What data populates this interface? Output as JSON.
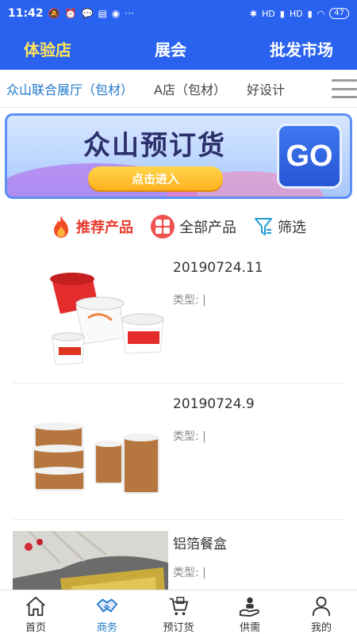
{
  "status_bar": {
    "time": "11:42",
    "battery": "47",
    "signal1": "HD",
    "signal2": "HD"
  },
  "header": {
    "items": [
      {
        "label": "体验店",
        "active": true
      },
      {
        "label": "展会",
        "active": false
      },
      {
        "label": "批发市场",
        "active": false
      }
    ]
  },
  "subtabs": [
    {
      "label": "众山联合展厅（包材）",
      "active": true
    },
    {
      "label": "A店（包材）",
      "active": false
    },
    {
      "label": "好设计",
      "active": false
    }
  ],
  "banner": {
    "title": "众山预订货",
    "enter_label": "点击进入",
    "go_label": "GO"
  },
  "filters": [
    {
      "label": "推荐产品",
      "icon": "fire-icon",
      "active": true
    },
    {
      "label": "全部产品",
      "icon": "grid-icon",
      "active": false
    },
    {
      "label": "筛选",
      "icon": "funnel-icon",
      "active": false
    }
  ],
  "products": [
    {
      "name": "20190724.11",
      "type_label": "类型: |"
    },
    {
      "name": "20190724.9",
      "type_label": "类型: |"
    },
    {
      "name": "铝箔餐盒",
      "type_label": "类型: |"
    }
  ],
  "bottom_nav": [
    {
      "label": "首页",
      "icon": "home-icon",
      "active": false
    },
    {
      "label": "商务",
      "icon": "handshake-icon",
      "active": true
    },
    {
      "label": "预订货",
      "icon": "cart-icon",
      "active": false
    },
    {
      "label": "供需",
      "icon": "supply-icon",
      "active": false
    },
    {
      "label": "我的",
      "icon": "user-icon",
      "active": false
    }
  ],
  "colors": {
    "primary": "#2a62f0",
    "active_header": "#ffe55c",
    "active_tab": "#1f78c8",
    "recommend": "#e83a2e"
  }
}
